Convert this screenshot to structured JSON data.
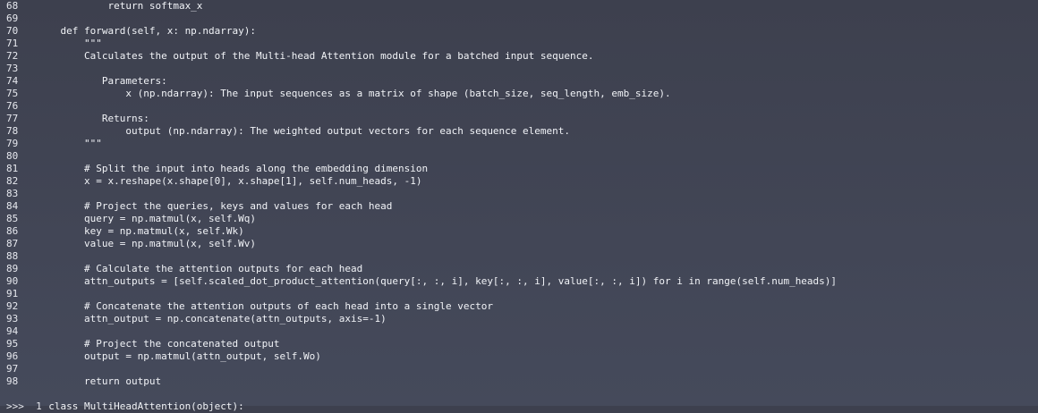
{
  "editor": {
    "lines": [
      {
        "no": "68",
        "code": "            return softmax_x"
      },
      {
        "no": "69",
        "code": ""
      },
      {
        "no": "70",
        "code": "    def forward(self, x: np.ndarray):"
      },
      {
        "no": "71",
        "code": "        \"\"\""
      },
      {
        "no": "72",
        "code": "        Calculates the output of the Multi-head Attention module for a batched input sequence."
      },
      {
        "no": "73",
        "code": ""
      },
      {
        "no": "74",
        "code": "           Parameters:"
      },
      {
        "no": "75",
        "code": "               x (np.ndarray): The input sequences as a matrix of shape (batch_size, seq_length, emb_size)."
      },
      {
        "no": "76",
        "code": ""
      },
      {
        "no": "77",
        "code": "           Returns:"
      },
      {
        "no": "78",
        "code": "               output (np.ndarray): The weighted output vectors for each sequence element."
      },
      {
        "no": "79",
        "code": "        \"\"\""
      },
      {
        "no": "80",
        "code": ""
      },
      {
        "no": "81",
        "code": "        # Split the input into heads along the embedding dimension"
      },
      {
        "no": "82",
        "code": "        x = x.reshape(x.shape[0], x.shape[1], self.num_heads, -1)"
      },
      {
        "no": "83",
        "code": ""
      },
      {
        "no": "84",
        "code": "        # Project the queries, keys and values for each head"
      },
      {
        "no": "85",
        "code": "        query = np.matmul(x, self.Wq)"
      },
      {
        "no": "86",
        "code": "        key = np.matmul(x, self.Wk)"
      },
      {
        "no": "87",
        "code": "        value = np.matmul(x, self.Wv)"
      },
      {
        "no": "88",
        "code": ""
      },
      {
        "no": "89",
        "code": "        # Calculate the attention outputs for each head"
      },
      {
        "no": "90",
        "code": "        attn_outputs = [self.scaled_dot_product_attention(query[:, :, i], key[:, :, i], value[:, :, i]) for i in range(self.num_heads)]"
      },
      {
        "no": "91",
        "code": ""
      },
      {
        "no": "92",
        "code": "        # Concatenate the attention outputs of each head into a single vector"
      },
      {
        "no": "93",
        "code": "        attn_output = np.concatenate(attn_outputs, axis=-1)"
      },
      {
        "no": "94",
        "code": ""
      },
      {
        "no": "95",
        "code": "        # Project the concatenated output"
      },
      {
        "no": "96",
        "code": "        output = np.matmul(attn_output, self.Wo)"
      },
      {
        "no": "97",
        "code": ""
      },
      {
        "no": "98",
        "code": "        return output"
      },
      {
        "no": "",
        "code": ""
      },
      {
        "no": ">>>  1",
        "code": "  class MultiHeadAttention(object):"
      }
    ]
  }
}
